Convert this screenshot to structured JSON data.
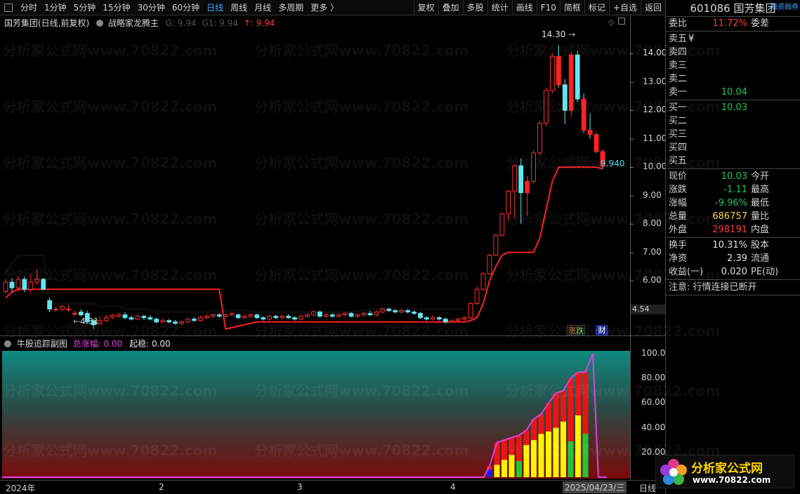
{
  "toolbar": {
    "periods": [
      "分时",
      "1分钟",
      "5分钟",
      "15分钟",
      "30分钟",
      "60分钟",
      "日线",
      "周线",
      "月线",
      "多周期",
      "更多 〉"
    ],
    "active_period": "日线",
    "actions": [
      "复权",
      "叠加",
      "多股",
      "统计",
      "画线",
      "F10",
      "简框",
      "标记",
      "+自选",
      "返回"
    ]
  },
  "main_header": {
    "title": "国芳集团(日线,前复权)",
    "indicator": "战略家龙腾主",
    "g_label": "G: 9.94",
    "g1_label": "G1: 9.94",
    "arrow_value": "↑: 9.94"
  },
  "price_axis": [
    "14.00",
    "13.00",
    "12.00",
    "11.00",
    "10.00",
    "9.00",
    "8.00",
    "7.00",
    "6.00"
  ],
  "price_box": "4.54",
  "annotations": {
    "high": "14.30",
    "low": "4.31",
    "last": "9.940"
  },
  "badges": {
    "zhangdie": "涨跌",
    "cai": "财"
  },
  "sub_header": {
    "name": "牛股追踪副图",
    "total_label": "总涨幅:",
    "total_value": "0.00",
    "qiwen_label": "起稳:",
    "qiwen_value": "0.00"
  },
  "sub_axis": [
    "100.0",
    "80.00",
    "60.00",
    "40.00",
    "20.00"
  ],
  "time_axis": [
    "2024年",
    "2",
    "3",
    "4",
    "2025/04/23/三"
  ],
  "time_axis_right": "日线",
  "watermark": "分析家公式网www.70822.com",
  "logo": {
    "text": "分析家公式网",
    "url": "www.70822.com"
  },
  "panel": {
    "code": "601086",
    "name": "国芳集团",
    "tag": "融资融券",
    "weibi_label": "委比",
    "weibi_value": "11.72%",
    "weicha_label": "委差",
    "sell": [
      {
        "label": "卖五",
        "price": "¥",
        "vol": ""
      },
      {
        "label": "卖四",
        "price": "",
        "vol": ""
      },
      {
        "label": "卖三",
        "price": "",
        "vol": ""
      },
      {
        "label": "卖二",
        "price": "",
        "vol": ""
      },
      {
        "label": "卖一",
        "price": "10.04",
        "vol": ""
      }
    ],
    "buy": [
      {
        "label": "买一",
        "price": "10.03",
        "vol": ""
      },
      {
        "label": "买二",
        "price": "",
        "vol": ""
      },
      {
        "label": "买三",
        "price": "",
        "vol": ""
      },
      {
        "label": "买四",
        "price": "",
        "vol": ""
      },
      {
        "label": "买五",
        "price": "",
        "vol": ""
      }
    ],
    "quote": [
      {
        "l": "现价",
        "v": "10.03",
        "c": "green",
        "r": "今开"
      },
      {
        "l": "涨跌",
        "v": "-1.11",
        "c": "green",
        "r": "最高"
      },
      {
        "l": "涨幅",
        "v": "-9.96%",
        "c": "green",
        "r": "最低"
      },
      {
        "l": "总量",
        "v": "686757",
        "c": "yellow",
        "r": "量比"
      },
      {
        "l": "外盘",
        "v": "298191",
        "c": "red",
        "r": "内盘"
      }
    ],
    "fin": [
      {
        "l": "换手",
        "v": "10.31%",
        "r": "股本"
      },
      {
        "l": "净资",
        "v": "2.39",
        "r": "流通"
      },
      {
        "l": "收益(一)",
        "v": "0.020",
        "r": "PE(动)"
      }
    ],
    "notice": "注意: 行情连接已断开"
  },
  "chart_data": {
    "type": "candlestick",
    "ylim": [
      4.1,
      14.6
    ],
    "candles": [
      [
        5.62,
        5.95,
        5.55,
        6.05
      ],
      [
        5.95,
        5.75,
        5.62,
        6.1
      ],
      [
        5.75,
        6.05,
        5.6,
        6.15
      ],
      [
        6.05,
        5.7,
        5.6,
        6.15
      ],
      [
        5.7,
        5.95,
        5.55,
        6.25
      ],
      [
        5.95,
        6.05,
        5.85,
        6.4
      ],
      [
        6.05,
        5.7,
        5.65,
        6.1
      ],
      [
        5.3,
        5.0,
        4.9,
        5.4
      ],
      [
        5.0,
        5.0,
        4.9,
        5.1
      ],
      [
        5.0,
        5.1,
        4.95,
        5.15
      ],
      [
        5.0,
        5.0,
        4.9,
        5.15
      ],
      [
        4.85,
        4.85,
        4.75,
        4.95
      ],
      [
        4.9,
        4.8,
        4.75,
        5.0
      ],
      [
        4.85,
        4.55,
        4.5,
        4.95
      ],
      [
        4.6,
        4.45,
        4.31,
        4.65
      ],
      [
        4.5,
        4.6,
        4.45,
        4.75
      ],
      [
        4.6,
        4.7,
        4.55,
        4.8
      ],
      [
        4.72,
        4.78,
        4.65,
        4.85
      ],
      [
        4.75,
        4.8,
        4.7,
        4.88
      ],
      [
        4.8,
        4.7,
        4.65,
        4.9
      ],
      [
        4.7,
        4.65,
        4.6,
        4.78
      ],
      [
        4.65,
        4.75,
        4.6,
        4.82
      ],
      [
        4.75,
        4.7,
        4.62,
        4.8
      ],
      [
        4.7,
        4.65,
        4.6,
        4.78
      ],
      [
        4.65,
        4.55,
        4.5,
        4.7
      ],
      [
        4.55,
        4.6,
        4.5,
        4.68
      ],
      [
        4.6,
        4.55,
        4.5,
        4.65
      ],
      [
        4.55,
        4.5,
        4.45,
        4.62
      ],
      [
        4.5,
        4.55,
        4.45,
        4.6
      ],
      [
        4.55,
        4.65,
        4.5,
        4.7
      ],
      [
        4.65,
        4.6,
        4.55,
        4.72
      ],
      [
        4.6,
        4.7,
        4.55,
        4.78
      ],
      [
        4.7,
        4.75,
        4.65,
        4.82
      ],
      [
        4.75,
        4.8,
        4.7,
        4.85
      ],
      [
        4.8,
        4.75,
        4.7,
        4.86
      ],
      [
        4.75,
        4.8,
        4.7,
        4.85
      ],
      [
        4.8,
        4.85,
        4.75,
        4.9
      ],
      [
        4.8,
        4.7,
        4.65,
        4.85
      ],
      [
        4.7,
        4.75,
        4.65,
        4.82
      ],
      [
        4.75,
        4.8,
        4.7,
        4.85
      ],
      [
        4.8,
        4.7,
        4.65,
        4.85
      ],
      [
        4.7,
        4.65,
        4.6,
        4.75
      ],
      [
        4.65,
        4.75,
        4.6,
        4.8
      ],
      [
        4.75,
        4.7,
        4.65,
        4.8
      ],
      [
        4.7,
        4.75,
        4.65,
        4.8
      ],
      [
        4.75,
        4.7,
        4.65,
        4.82
      ],
      [
        4.7,
        4.65,
        4.6,
        4.75
      ],
      [
        4.65,
        4.75,
        4.6,
        4.8
      ],
      [
        4.75,
        4.8,
        4.7,
        4.85
      ],
      [
        4.8,
        4.9,
        4.75,
        4.95
      ],
      [
        4.9,
        4.75,
        4.7,
        4.95
      ],
      [
        4.75,
        4.8,
        4.7,
        4.85
      ],
      [
        4.8,
        4.75,
        4.7,
        4.85
      ],
      [
        4.75,
        4.8,
        4.7,
        4.85
      ],
      [
        4.8,
        4.85,
        4.75,
        4.9
      ],
      [
        4.85,
        4.75,
        4.7,
        4.9
      ],
      [
        4.75,
        4.8,
        4.7,
        4.85
      ],
      [
        4.8,
        4.85,
        4.75,
        4.9
      ],
      [
        4.85,
        4.8,
        4.75,
        4.95
      ],
      [
        4.8,
        4.9,
        4.75,
        4.95
      ],
      [
        4.9,
        5.0,
        4.85,
        5.05
      ],
      [
        5.0,
        4.95,
        4.9,
        5.05
      ],
      [
        4.95,
        4.9,
        4.85,
        5.0
      ],
      [
        4.9,
        4.95,
        4.85,
        5.0
      ],
      [
        4.95,
        4.9,
        4.85,
        5.0
      ],
      [
        4.9,
        4.85,
        4.8,
        4.95
      ],
      [
        4.85,
        4.7,
        4.65,
        4.9
      ],
      [
        4.7,
        4.65,
        4.6,
        4.75
      ],
      [
        4.65,
        4.7,
        4.6,
        4.78
      ],
      [
        4.7,
        4.65,
        4.6,
        4.75
      ],
      [
        4.65,
        4.55,
        4.5,
        4.7
      ],
      [
        4.55,
        4.6,
        4.5,
        4.65
      ],
      [
        4.6,
        4.65,
        4.55,
        4.7
      ],
      [
        4.65,
        4.7,
        4.6,
        4.75
      ],
      [
        4.7,
        5.2,
        4.65,
        5.25
      ],
      [
        5.2,
        5.7,
        5.15,
        5.8
      ],
      [
        5.7,
        6.25,
        5.65,
        6.3
      ],
      [
        6.25,
        6.9,
        6.2,
        6.95
      ],
      [
        6.9,
        7.6,
        6.85,
        7.65
      ],
      [
        7.6,
        8.35,
        7.55,
        8.4
      ],
      [
        8.35,
        9.15,
        8.1,
        9.2
      ],
      [
        9.15,
        10.05,
        8.2,
        10.1
      ],
      [
        10.05,
        9.1,
        8.0,
        10.3
      ],
      [
        9.1,
        9.5,
        8.3,
        9.7
      ],
      [
        9.5,
        10.5,
        9.4,
        10.6
      ],
      [
        10.5,
        11.55,
        10.4,
        11.65
      ],
      [
        11.55,
        12.7,
        11.45,
        12.8
      ],
      [
        12.7,
        13.9,
        12.6,
        14.0
      ],
      [
        13.9,
        12.9,
        12.8,
        14.3
      ],
      [
        12.9,
        12.0,
        11.5,
        13.1
      ],
      [
        12.0,
        13.95,
        11.8,
        14.05
      ],
      [
        13.95,
        12.4,
        12.3,
        14.1
      ],
      [
        12.4,
        11.3,
        11.2,
        12.6
      ],
      [
        11.3,
        11.15,
        11.0,
        11.9
      ],
      [
        11.15,
        10.55,
        10.5,
        11.2
      ],
      [
        10.55,
        10.03,
        9.94,
        10.6
      ]
    ],
    "support_line": [
      5.4,
      5.6,
      5.7,
      5.7,
      5.7,
      5.7,
      5.7,
      5.7,
      5.7,
      5.7,
      5.7,
      5.7,
      5.7,
      5.7,
      5.7,
      5.7,
      5.7,
      5.7,
      5.7,
      5.7,
      5.7,
      5.7,
      5.7,
      5.7,
      5.7,
      5.7,
      5.7,
      5.7,
      5.7,
      5.7,
      5.7,
      5.7,
      5.7,
      5.7,
      5.7,
      4.3,
      4.35,
      4.4,
      4.45,
      4.5,
      4.55,
      4.55,
      4.55,
      4.55,
      4.55,
      4.55,
      4.55,
      4.55,
      4.55,
      4.55,
      4.55,
      4.55,
      4.55,
      4.55,
      4.55,
      4.55,
      4.55,
      4.55,
      4.55,
      4.55,
      4.55,
      4.55,
      4.55,
      4.55,
      4.55,
      4.55,
      4.55,
      4.55,
      4.55,
      4.55,
      4.55,
      4.55,
      4.55,
      4.55,
      4.6,
      4.7,
      5.2,
      6.0,
      6.5,
      6.9,
      7.0,
      7.0,
      7.0,
      7.0,
      7.0,
      7.5,
      8.5,
      9.5,
      10.0,
      10.0,
      10.0,
      10.0,
      10.0,
      10.0,
      10.0,
      9.94
    ],
    "upper_line": [
      6.3,
      6.6,
      6.85,
      6.9,
      6.9,
      6.9,
      6.9,
      5.2,
      5.2,
      5.2,
      5.2,
      5.2,
      5.2,
      5.2,
      5.2,
      5.1,
      5.1,
      5.1,
      5.1,
      5.0,
      5.0,
      5.0,
      5.0,
      4.95,
      4.95,
      4.9,
      4.9,
      4.9,
      4.9,
      4.9,
      4.9,
      4.9,
      4.9,
      4.95,
      4.95,
      4.95,
      4.95,
      4.95,
      4.95,
      4.95,
      4.9,
      4.9,
      4.9,
      4.9,
      4.9,
      4.9,
      4.9,
      4.9,
      4.9,
      4.9,
      4.9,
      4.9,
      4.9,
      4.9,
      4.9,
      4.9,
      4.95,
      4.95,
      5.0,
      5.0,
      5.0,
      5.0,
      5.0,
      5.0,
      5.0,
      5.0,
      5.0,
      5.0,
      5.0,
      5.0,
      5.0,
      5.0,
      5.0,
      5.0
    ],
    "sub_bars": [
      {
        "red": 9,
        "yellow": 0,
        "green": 0,
        "blue": 6
      },
      {
        "red": 28,
        "yellow": 10,
        "green": 0,
        "blue": 0
      },
      {
        "red": 30,
        "yellow": 14,
        "green": 0,
        "blue": 0
      },
      {
        "red": 32,
        "yellow": 18,
        "green": 0,
        "blue": 0
      },
      {
        "red": 34,
        "yellow": 10,
        "green": 13,
        "blue": 0
      },
      {
        "red": 38,
        "yellow": 26,
        "green": 0,
        "blue": 0
      },
      {
        "red": 47,
        "yellow": 30,
        "green": 0,
        "blue": 0
      },
      {
        "red": 51,
        "yellow": 35,
        "green": 0,
        "blue": 0
      },
      {
        "red": 60,
        "yellow": 37,
        "green": 0,
        "blue": 0
      },
      {
        "red": 68,
        "yellow": 40,
        "green": 0,
        "blue": 0
      },
      {
        "red": 70,
        "yellow": 45,
        "green": 0,
        "blue": 0
      },
      {
        "red": 80,
        "yellow": 29,
        "green": 29,
        "blue": 0
      },
      {
        "red": 85,
        "yellow": 50,
        "green": 0,
        "blue": 0
      },
      {
        "red": 85,
        "yellow": 35,
        "green": 35,
        "blue": 0
      }
    ]
  }
}
